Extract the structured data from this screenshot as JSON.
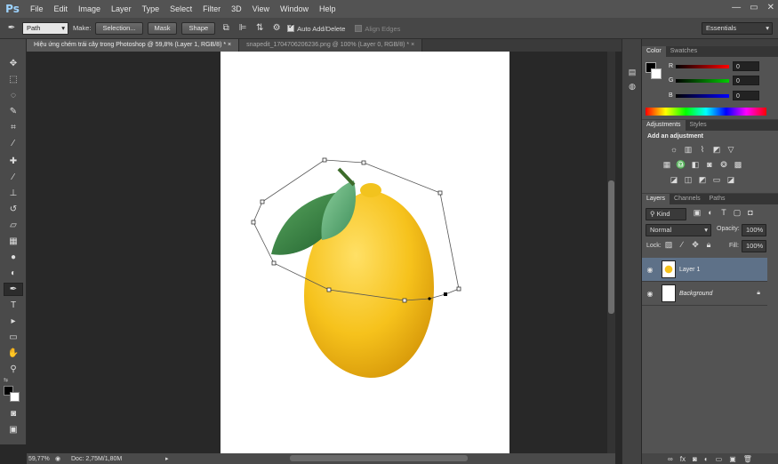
{
  "app": {
    "logo": "Ps"
  },
  "menu": [
    "File",
    "Edit",
    "Image",
    "Layer",
    "Type",
    "Select",
    "Filter",
    "3D",
    "View",
    "Window",
    "Help"
  ],
  "options": {
    "mode_value": "Path",
    "make_label": "Make:",
    "selection_btn": "Selection...",
    "mask_btn": "Mask",
    "shape_btn": "Shape",
    "auto_add_delete": "Auto Add/Delete",
    "align_edges": "Align Edges",
    "workspace": "Essentials"
  },
  "tabs": [
    {
      "label": "Hiệu ứng chém trái cây trong Photoshop @ 59,8% (Layer 1, RGB/8) *"
    },
    {
      "label": "snapedit_1704706206236.png @ 100% (Layer 0, RGB/8) *"
    }
  ],
  "status": {
    "zoom": "59,77%",
    "doc": "Doc: 2,75M/1,80M"
  },
  "color_panel": {
    "tabs": [
      "Color",
      "Swatches"
    ],
    "channels": [
      {
        "label": "R",
        "value": "0",
        "color": "#d00000"
      },
      {
        "label": "G",
        "value": "0",
        "color": "#00a000"
      },
      {
        "label": "B",
        "value": "0",
        "color": "#0000d0"
      }
    ]
  },
  "adjustments_panel": {
    "tabs": [
      "Adjustments",
      "Styles"
    ],
    "title": "Add an adjustment"
  },
  "layers_panel": {
    "tabs": [
      "Layers",
      "Channels",
      "Paths"
    ],
    "kind": "Kind",
    "blend_mode": "Normal",
    "opacity_label": "Opacity:",
    "opacity_value": "100%",
    "lock_label": "Lock:",
    "fill_label": "Fill:",
    "fill_value": "100%",
    "layers": [
      {
        "name": "Layer 1",
        "selected": true
      },
      {
        "name": "Background",
        "selected": false
      }
    ]
  }
}
